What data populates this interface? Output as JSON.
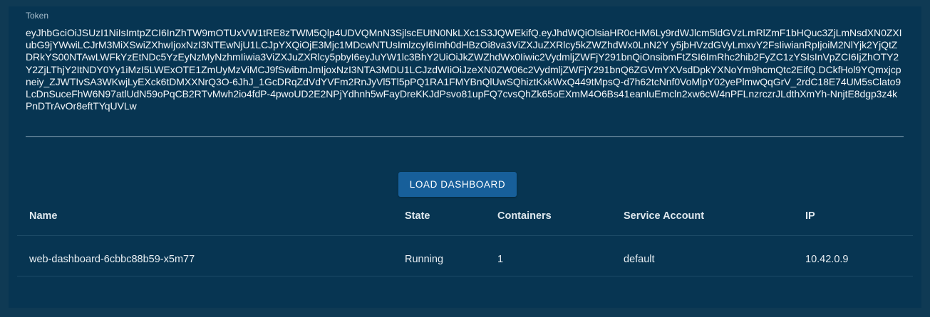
{
  "token": {
    "label": "Token",
    "value": "eyJhbGciOiJSUzI1NiIsImtpZCI6InZhTW9mOTUxVW1tRE8zTWM5Qlp4UDVQMnN3SjlscEUtN0NkLXc1S3JQWEkifQ.eyJhdWQiOlsiaHR0cHM6Ly9rdWJlcm5ldGVzLmRlZmF1bHQuc3ZjLmNsdXN0ZXIubG9jYWwiLCJrM3MiXSwiZXhwIjoxNzI3NTEwNjU1LCJpYXQiOjE3Mjc1MDcwNTUsImlzcyI6Imh0dHBzOi8va3ViZXJuZXRlcy5kZWZhdWx0LnN2Y y5jbHVzdGVyLmxvY2FsIiwianRpIjoiM2NlYjk2YjQtZDRkYS00NTAwLWFkYzEtNDc5YzEyNzMyNzhmIiwia3ViZXJuZXRlcy5pbyI6eyJuYW1lc3BhY2UiOiJkZWZhdWx0Iiwic2VydmljZWFjY291bnQiOnsibmFtZSI6ImRhc2hib2FyZC1zYSIsInVpZCI6IjZhOTY2Y2ZjLThjY2ItNDY0Yy1iMzI5LWExOTE1ZmUyMzViMCJ9fSwibmJmIjoxNzI3NTA3MDU1LCJzdWIiOiJzeXN0ZW06c2VydmljZWFjY291bnQ6ZGVmYXVsdDpkYXNoYm9hcmQtc2EifQ.DCkfHol9YQmxjcpneiy_ZJWTIvSA3WKwjLyEXck6tDMXXNrQ3O-6JhJ_1GcDRqZdVdYVFm2RnJyVl5Tl5pPQ1RA1FMYBnQlUwSQhiztKxkWxQ449tMpsQ-d7h62tcNnf0VoMlpY02yePlmwQqGrV_2rdC18E74UM5sClato9LcDnSuceFhW6N97atlUdN59oPqCB2RTvMwh2io4fdP-4pwoUD2E2NPjYdhnh5wFayDreKKJdPsvo81upFQ7cvsQhZk65oEXmM4O6Bs41eanIuEmcln2xw6cW4nPFLnzrczrJLdthXmYh-NnjtE8dgp3z4kPnDTrAvOr8eftTYqUVLw"
  },
  "actions": {
    "load_label": "LOAD DASHBOARD"
  },
  "table": {
    "columns": [
      "Name",
      "State",
      "Containers",
      "Service Account",
      "IP"
    ],
    "rows": [
      [
        "web-dashboard-6cbbc88b59-x5m77",
        "Running",
        "1",
        "default",
        "10.42.0.9"
      ]
    ]
  },
  "colors": {
    "background": "#0f3a54",
    "panel": "#073552",
    "button": "#175f9a"
  }
}
